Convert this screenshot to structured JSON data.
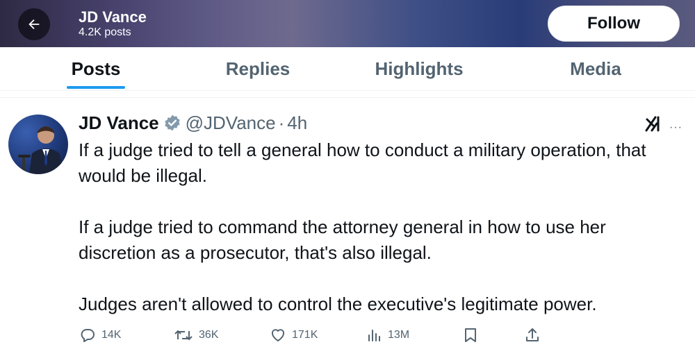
{
  "header": {
    "name": "JD Vance",
    "post_count": "4.2K posts",
    "follow_label": "Follow"
  },
  "tabs": [
    {
      "label": "Posts",
      "active": true
    },
    {
      "label": "Replies",
      "active": false
    },
    {
      "label": "Highlights",
      "active": false
    },
    {
      "label": "Media",
      "active": false
    }
  ],
  "tweet": {
    "author_name": "JD Vance",
    "handle": "@JDVance",
    "separator": "·",
    "time": "4h",
    "paragraphs": [
      [
        "If a judge tried to tell a general how to conduct a military operation, that",
        "would be illegal."
      ],
      [
        "If a judge tried to command the attorney general in how to use her",
        "discretion as a prosecutor, that's also illegal."
      ],
      [
        "Judges aren't allowed to control the executive's legitimate power."
      ]
    ],
    "more_label": "···",
    "stats": {
      "replies": "14K",
      "reposts": "36K",
      "likes": "171K",
      "views": "13M"
    }
  },
  "colors": {
    "accent": "#1d9bf0",
    "secondary_text": "#536471",
    "primary_text": "#0f1419"
  },
  "icons": [
    "back-arrow-icon",
    "verified-badge-icon",
    "grok-icon",
    "more-icon",
    "reply-icon",
    "repost-icon",
    "like-icon",
    "views-icon",
    "bookmark-icon",
    "share-icon"
  ]
}
